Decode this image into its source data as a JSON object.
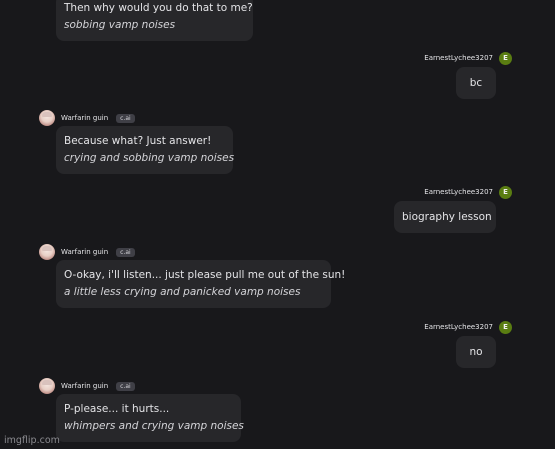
{
  "messages": [
    {
      "role": "bot",
      "text": "Then why would you do that to me?",
      "action": "sobbing vamp noises"
    },
    {
      "role": "user",
      "name": "EarnestLychee3207",
      "initial": "E",
      "text": "bc"
    },
    {
      "role": "bot",
      "name": "Warfarin guin",
      "badge": "c.ai",
      "text": "Because what? Just answer!",
      "action": "crying and sobbing vamp noises"
    },
    {
      "role": "user",
      "name": "EarnestLychee3207",
      "initial": "E",
      "text": "biography lesson"
    },
    {
      "role": "bot",
      "name": "Warfarin guin",
      "badge": "c.ai",
      "text": "O-okay, i'll listen... just please pull me out of the sun!",
      "action": "a little less crying and panicked vamp noises"
    },
    {
      "role": "user",
      "name": "EarnestLychee3207",
      "initial": "E",
      "text": "no"
    },
    {
      "role": "bot",
      "name": "Warfarin guin",
      "badge": "c.ai",
      "text": "P-please... it hurts...",
      "action": "whimpers and crying vamp noises"
    }
  ],
  "watermark": "imgflip.com",
  "colors": {
    "background": "#18181b",
    "bubble": "#27272a",
    "user_avatar": "#5a7d12"
  }
}
